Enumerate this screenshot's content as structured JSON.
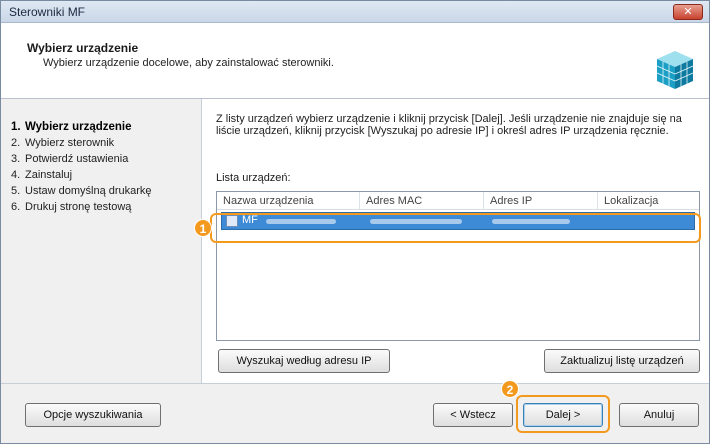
{
  "window": {
    "title": "Sterowniki MF",
    "close_glyph": "✕"
  },
  "header": {
    "title": "Wybierz urządzenie",
    "subtitle": "Wybierz urządzenie docelowe, aby zainstalować sterowniki."
  },
  "steps": [
    {
      "num": "1.",
      "label": "Wybierz urządzenie",
      "active": true
    },
    {
      "num": "2.",
      "label": "Wybierz sterownik"
    },
    {
      "num": "3.",
      "label": "Potwierdź ustawienia"
    },
    {
      "num": "4.",
      "label": "Zainstaluj"
    },
    {
      "num": "5.",
      "label": "Ustaw domyślną drukarkę"
    },
    {
      "num": "6.",
      "label": "Drukuj stronę testową"
    }
  ],
  "content": {
    "description": "Z listy urządzeń wybierz urządzenie i kliknij przycisk [Dalej]. Jeśli urządzenie nie znajduje się na liście urządzeń, kliknij przycisk [Wyszukaj po adresie IP] i określ adres IP urządzenia ręcznie.",
    "list_label": "Lista urządzeń:",
    "columns": [
      "Nazwa urządzenia",
      "Adres MAC",
      "Adres IP",
      "Lokalizacja"
    ],
    "rows": [
      {
        "name": "MF"
      }
    ]
  },
  "buttons": {
    "search_ip": "Wyszukaj według adresu IP",
    "refresh": "Zaktualizuj listę urządzeń",
    "search_options": "Opcje wyszukiwania",
    "back": "< Wstecz",
    "next": "Dalej >",
    "cancel": "Anuluj"
  },
  "callouts": [
    "1",
    "2"
  ],
  "colors": {
    "callout": "#f39a1e",
    "selection": "#3d8ad6"
  }
}
